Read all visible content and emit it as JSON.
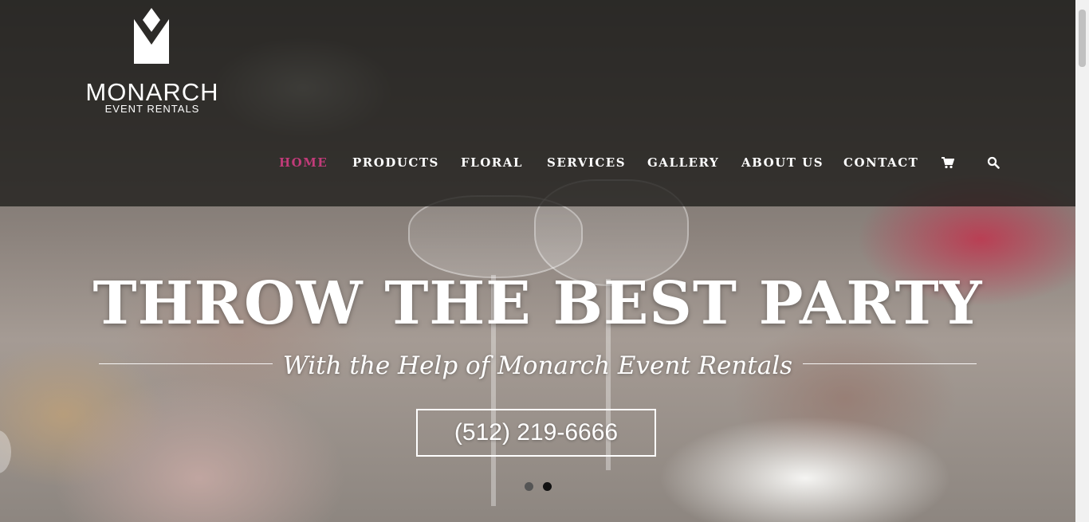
{
  "logo": {
    "title": "MONARCH",
    "subtitle": "EVENT RENTALS",
    "mark_icon": "monarch-diamond-logo"
  },
  "nav": {
    "items": [
      {
        "label": "HOME",
        "active": true
      },
      {
        "label": "PRODUCTS",
        "active": false
      },
      {
        "label": "FLORAL",
        "active": false
      },
      {
        "label": "SERVICES",
        "active": false
      },
      {
        "label": "GALLERY",
        "active": false
      },
      {
        "label": "ABOUT US",
        "active": false
      },
      {
        "label": "CONTACT",
        "active": false
      }
    ],
    "cart_icon": "cart-icon",
    "search_icon": "search-icon",
    "active_color": "#c13b79"
  },
  "hero": {
    "headline": "THROW THE BEST PARTY",
    "subheadline": "With the Help of Monarch Event Rentals",
    "phone": "(512) 219-6666",
    "slides_total": 2,
    "active_slide": 2
  }
}
